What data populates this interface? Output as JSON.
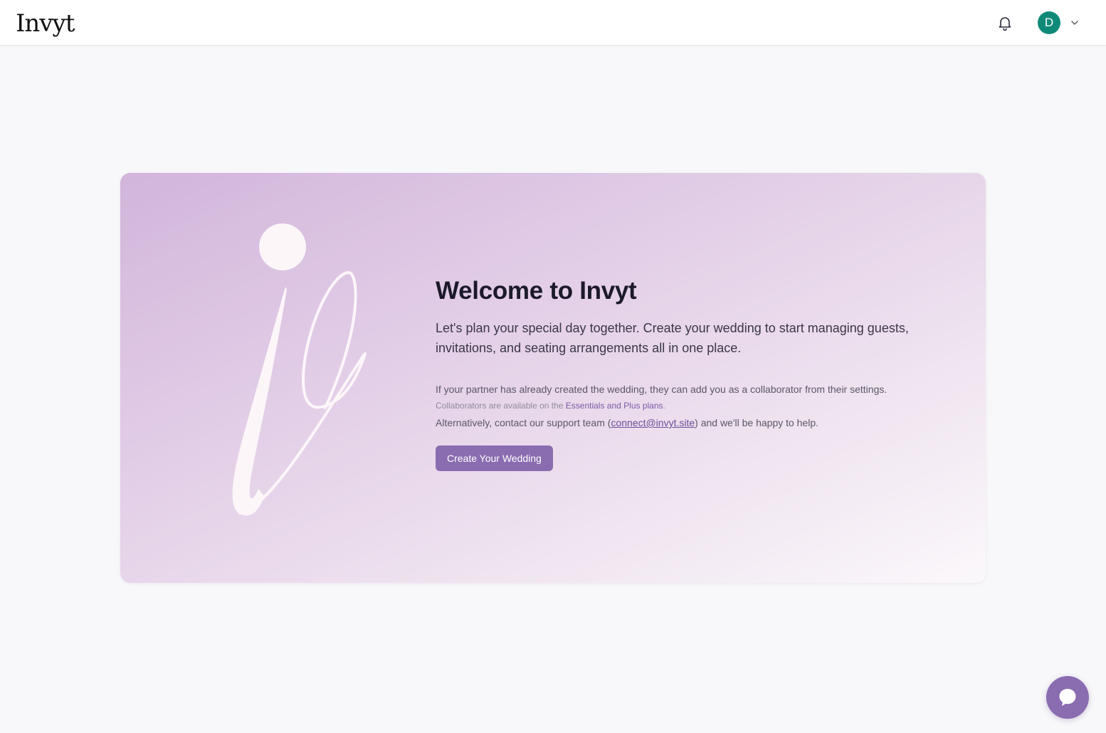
{
  "header": {
    "logo_text": "Invyt",
    "avatar_initial": "D"
  },
  "welcome": {
    "title": "Welcome to Invyt",
    "lead": "Let's plan your special day together. Create your wedding to start managing guests, invitations, and seating arrangements all in one place.",
    "partner_note": "If your partner has already created the wedding, they can add you as a collaborator from their settings.",
    "collab_prefix": "Collaborators are available on the ",
    "collab_link": "Essentials and Plus plans",
    "collab_suffix": ".",
    "support_prefix": "Alternatively, contact our support team (",
    "support_email": "connect@invyt.site",
    "support_suffix": ") and we'll be happy to help.",
    "cta_label": "Create Your Wedding"
  },
  "icons": {
    "bell": "bell-icon",
    "chevron": "chevron-down-icon",
    "chat": "chat-bubble-icon",
    "brand_mark": "brand-mark-icon"
  },
  "colors": {
    "accent": "#8a6cb1",
    "avatar": "#0f8a78",
    "card_gradient_start": "#d2b5db",
    "card_gradient_end": "#fbf8fb"
  }
}
